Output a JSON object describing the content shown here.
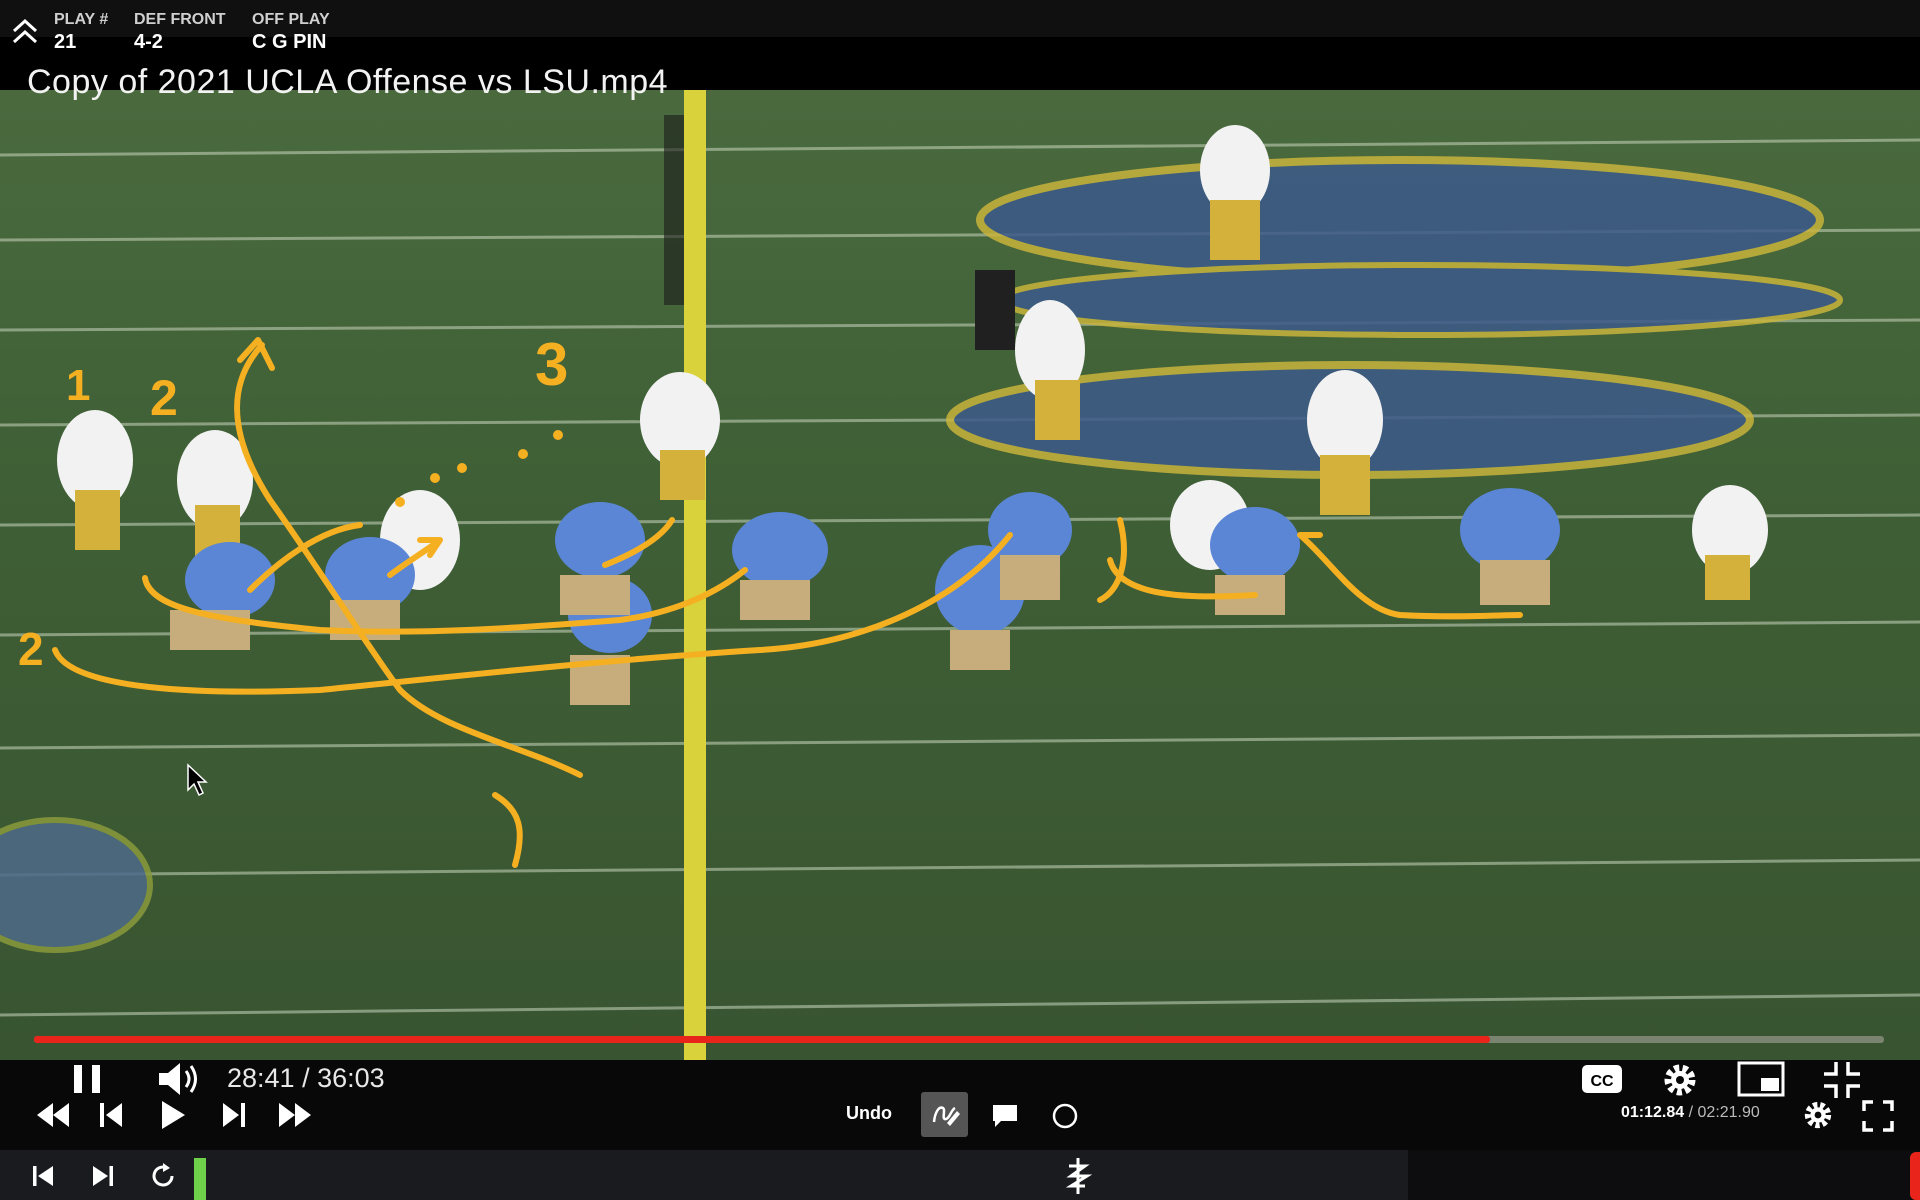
{
  "header": {
    "play_label": "PLAY #",
    "play_value": "21",
    "def_front_label": "DEF FRONT",
    "def_front_value": "4-2",
    "off_play_label": "OFF PLAY",
    "off_play_value": "C G PIN"
  },
  "video": {
    "title": "Copy of 2021 UCLA Offense vs LSU.mp4",
    "progress_fraction": 0.787,
    "annotations": [
      "1",
      "2",
      "3",
      "2"
    ]
  },
  "controls": {
    "time_display": "28:41 / 36:03",
    "undo_label": "Undo",
    "clip_time_current": "01:12.84",
    "clip_time_separator": " / ",
    "clip_time_total": "02:21.90"
  },
  "colors": {
    "annotation": "#f5b021",
    "seek_fill": "#e8241b",
    "marker_green": "#6fd14a"
  }
}
